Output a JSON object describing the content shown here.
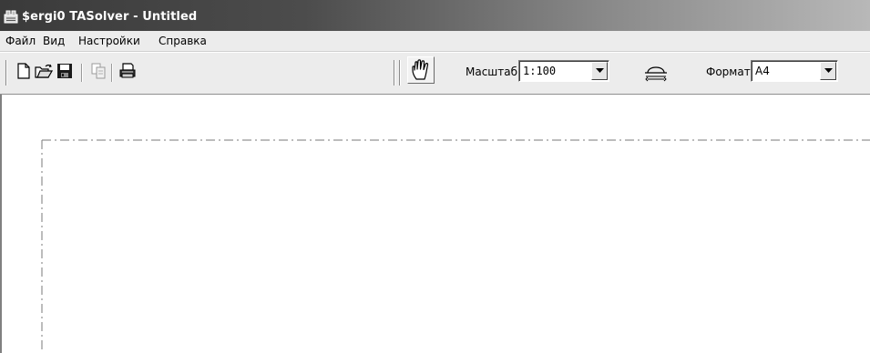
{
  "window": {
    "title": "$ergi0 TASolver - Untitled"
  },
  "menu": {
    "items": [
      "Файл",
      "Вид",
      "Настройки",
      "Справка"
    ]
  },
  "toolbar": {
    "icons": {
      "new": "new-document-icon",
      "open": "open-folder-icon",
      "save": "save-disk-icon",
      "copy": "copy-icon",
      "print": "print-icon",
      "hand": "hand-pan-icon",
      "orientation": "page-orientation-icon"
    },
    "scale_label": "Масштаб",
    "scale_value": "1:100",
    "format_label": "Формат",
    "format_value": "A4"
  }
}
